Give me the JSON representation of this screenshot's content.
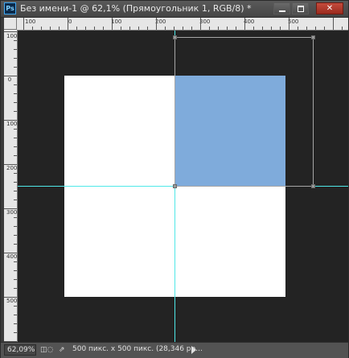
{
  "window": {
    "logo_text": "Ps",
    "title": "Без имени-1 @ 62,1% (Прямоугольник 1, RGB/8) *",
    "minimize_label": "",
    "maximize_label": "",
    "close_label": "✕"
  },
  "ruler_top": {
    "labels": [
      "100",
      "0",
      "100",
      "200",
      "300",
      "400",
      "500"
    ]
  },
  "ruler_left": {
    "labels": [
      "100",
      "0",
      "100",
      "200",
      "300",
      "400",
      "500"
    ]
  },
  "canvas": {
    "document_color": "#ffffff",
    "layer_color": "#7fabdb",
    "guide_color": "#4fe8e8",
    "pasteboard_color": "#232323"
  },
  "status": {
    "zoom": "62,09%",
    "doc_info": "500 пикс. x 500 пикс. (28,346 рр...",
    "icons": [
      "status-warning-icon",
      "share-icon"
    ]
  }
}
